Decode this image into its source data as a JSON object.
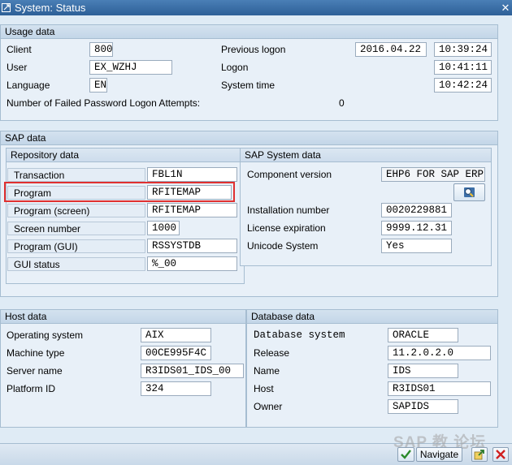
{
  "window": {
    "title": "System: Status",
    "close_glyph": "✕"
  },
  "usage": {
    "header": "Usage data",
    "client_label": "Client",
    "client_value": "800",
    "user_label": "User",
    "user_value": "EX_WZHJ",
    "language_label": "Language",
    "language_value": "EN",
    "prev_logon_label": "Previous logon",
    "prev_logon_date": "2016.04.22",
    "prev_logon_time": "10:39:24",
    "logon_label": "Logon",
    "logon_time": "10:41:11",
    "system_time_label": "System time",
    "system_time": "10:42:24",
    "failed_label": "Number of Failed Password Logon Attempts:",
    "failed_value": "0"
  },
  "sap": {
    "header": "SAP data",
    "repo": {
      "header": "Repository data",
      "transaction_label": "Transaction",
      "transaction_value": "FBL1N",
      "program_label": "Program",
      "program_value": "RFITEMAP",
      "program_screen_label": "Program (screen)",
      "program_screen_value": "RFITEMAP",
      "screen_number_label": "Screen number",
      "screen_number_value": "1000",
      "program_gui_label": "Program (GUI)",
      "program_gui_value": "RSSYSTDB",
      "gui_status_label": "GUI status",
      "gui_status_value": "%_00"
    },
    "system": {
      "header": "SAP System data",
      "component_label": "Component version",
      "component_value": "EHP6 FOR SAP ERP ...",
      "installation_label": "Installation number",
      "installation_value": "0020229881",
      "license_label": "License expiration",
      "license_value": "9999.12.31",
      "unicode_label": "Unicode System",
      "unicode_value": "Yes"
    }
  },
  "host": {
    "header": "Host data",
    "os_label": "Operating system",
    "os_value": "AIX",
    "machine_label": "Machine type",
    "machine_value": "00CE995F4C",
    "server_label": "Server name",
    "server_value": "R3IDS01_IDS_00",
    "platform_label": "Platform ID",
    "platform_value": "324"
  },
  "db": {
    "header": "Database data",
    "system_label": "Database system",
    "system_value": "ORACLE",
    "release_label": "Release",
    "release_value": "11.2.0.2.0",
    "name_label": "Name",
    "name_value": "IDS",
    "host_label": "Host",
    "host_value": "R3IDS01",
    "owner_label": "Owner",
    "owner_value": "SAPIDS"
  },
  "footer": {
    "navigate_label": "Navigate",
    "watermark": "SAP 教 论坛"
  }
}
